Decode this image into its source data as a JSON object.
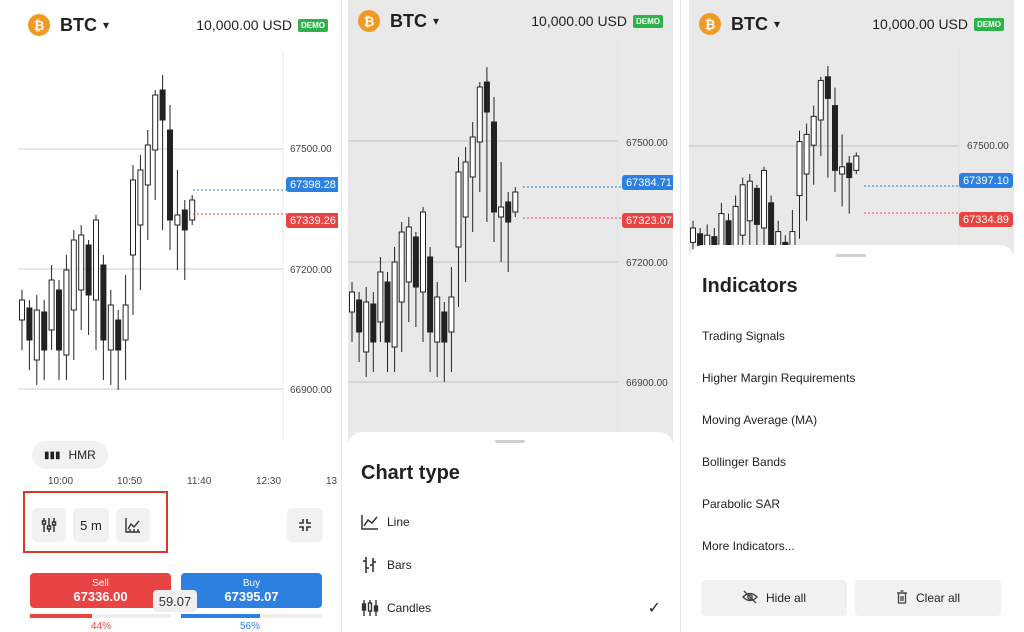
{
  "header": {
    "coin_glyph": "₿",
    "symbol": "BTC",
    "chevron": "▾",
    "balance": "10,000.00 USD",
    "demo_badge": "DEMO"
  },
  "panel1": {
    "price_labels": [
      "67500.00",
      "67200.00",
      "66900.00"
    ],
    "ask_tag": "67398.28",
    "bid_tag": "67339.26",
    "time_labels": [
      "10:00",
      "10:50",
      "11:40",
      "12:30",
      "13"
    ],
    "hmr_label": "HMR",
    "toolbar": {
      "indicators_icon": "indicators-icon",
      "timeframe_label": "5 m",
      "chart_type_icon": "chart-type-icon",
      "collapse_icon": "collapse-icon"
    },
    "sell": {
      "label": "Sell",
      "price": "67336.00",
      "percent": "44%"
    },
    "buy": {
      "label": "Buy",
      "price": "67395.07",
      "percent": "56%"
    },
    "spread": "59.07"
  },
  "panel2": {
    "price_labels": [
      "67500.00",
      "67200.00",
      "66900.00"
    ],
    "ask_tag": "67384.71",
    "bid_tag": "67323.07",
    "sheet_title": "Chart type",
    "options": [
      {
        "label": "Line",
        "icon": "line-chart-icon"
      },
      {
        "label": "Bars",
        "icon": "bars-chart-icon"
      },
      {
        "label": "Candles",
        "icon": "candles-chart-icon",
        "selected": true
      }
    ],
    "check_glyph": "✓"
  },
  "panel3": {
    "price_labels": [
      "67500.00"
    ],
    "ask_tag": "67397.10",
    "bid_tag": "67334.89",
    "sheet_title": "Indicators",
    "items": [
      "Trading Signals",
      "Higher Margin Requirements",
      "Moving Average (MA)",
      "Bollinger Bands",
      "Parabolic SAR",
      "More Indicators..."
    ],
    "hide_all_label": "Hide all",
    "clear_all_label": "Clear all"
  },
  "colors": {
    "sell": "#e84444",
    "buy": "#2d7fe0",
    "demo": "#2db34a",
    "coin": "#f09a26",
    "highlight": "#d9382c"
  }
}
